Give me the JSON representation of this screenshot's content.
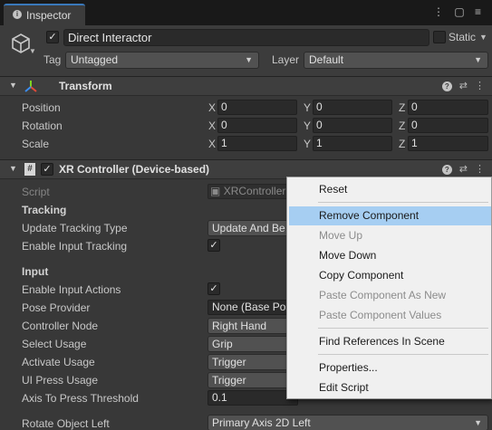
{
  "window": {
    "tab_label": "Inspector",
    "tab_actions": "⋮ ▢ ≡"
  },
  "header": {
    "active": "✓",
    "object_name": "Direct Interactor",
    "static_label": "Static",
    "tag_label": "Tag",
    "tag_value": "Untagged",
    "layer_label": "Layer",
    "layer_value": "Default"
  },
  "transform": {
    "title": "Transform",
    "rows": [
      {
        "label": "Position",
        "x": "0",
        "y": "0",
        "z": "0"
      },
      {
        "label": "Rotation",
        "x": "0",
        "y": "0",
        "z": "0"
      },
      {
        "label": "Scale",
        "x": "1",
        "y": "1",
        "z": "1"
      }
    ],
    "axes": {
      "x": "X",
      "y": "Y",
      "z": "Z"
    }
  },
  "xr_controller": {
    "enabled": "✓",
    "script_icon": "#",
    "title": "XR Controller (Device-based)",
    "script_label": "Script",
    "script_value": "XRController",
    "tracking_section": "Tracking",
    "update_tracking_type_label": "Update Tracking Type",
    "update_tracking_type_value": "Update And Be",
    "enable_input_tracking_label": "Enable Input Tracking",
    "enable_input_tracking_value": "✓",
    "input_section": "Input",
    "enable_input_actions_label": "Enable Input Actions",
    "enable_input_actions_value": "✓",
    "pose_provider_label": "Pose Provider",
    "pose_provider_value": "None (Base Pos",
    "controller_node_label": "Controller Node",
    "controller_node_value": "Right Hand",
    "select_usage_label": "Select Usage",
    "select_usage_value": "Grip",
    "activate_usage_label": "Activate Usage",
    "activate_usage_value": "Trigger",
    "ui_press_usage_label": "UI Press Usage",
    "ui_press_usage_value": "Trigger",
    "axis_threshold_label": "Axis To Press Threshold",
    "axis_threshold_value": "0.1",
    "rotate_object_left_label": "Rotate Object Left",
    "rotate_object_left_value": "Primary Axis 2D Left"
  },
  "context_menu": {
    "items": [
      {
        "label": "Reset",
        "enabled": true
      },
      {
        "label": "Remove Component",
        "enabled": true,
        "highlighted": true
      },
      {
        "label": "Move Up",
        "enabled": false
      },
      {
        "label": "Move Down",
        "enabled": true
      },
      {
        "label": "Copy Component",
        "enabled": true
      },
      {
        "label": "Paste Component As New",
        "enabled": false
      },
      {
        "label": "Paste Component Values",
        "enabled": false
      },
      {
        "label": "Find References In Scene",
        "enabled": true
      },
      {
        "label": "Properties...",
        "enabled": true
      },
      {
        "label": "Edit Script",
        "enabled": true
      }
    ]
  },
  "colors": {
    "highlight": "#a6cef2",
    "accent": "#3a79bb",
    "axis_red": "#e04a3a",
    "axis_green": "#7ed321",
    "axis_blue": "#3c8df0"
  }
}
